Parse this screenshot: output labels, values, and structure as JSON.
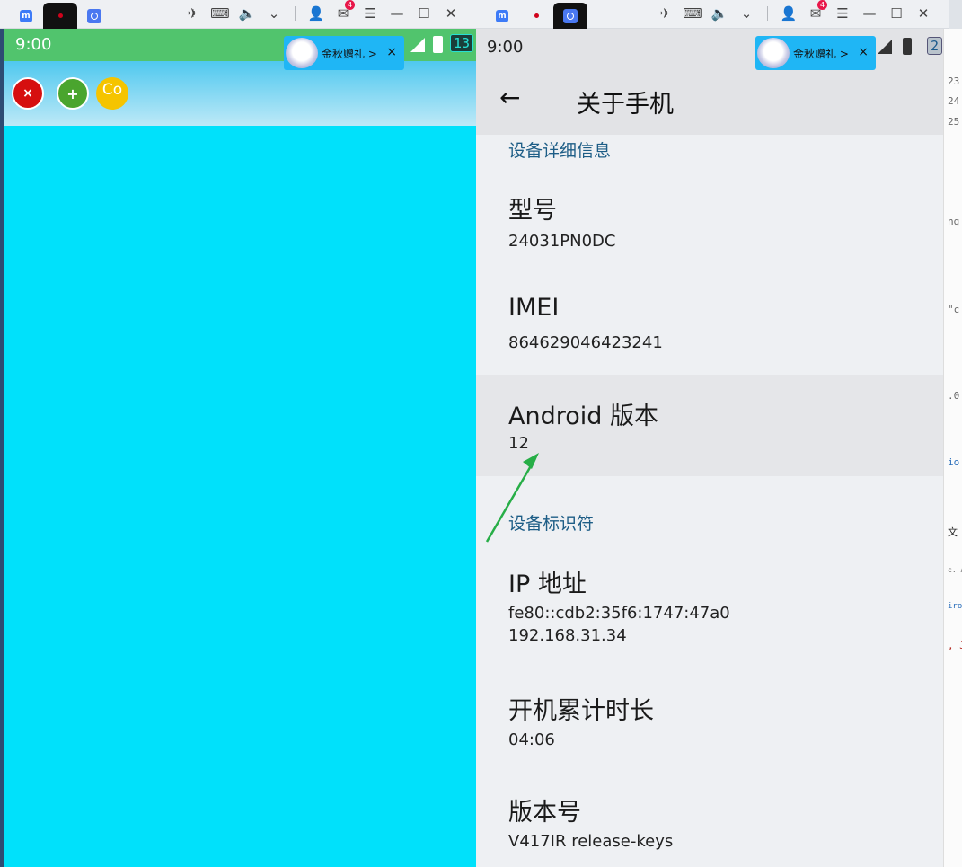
{
  "left_window": {
    "titlebar": {
      "mail_badge": "4"
    },
    "status": {
      "time": "9:00",
      "notif_count": "13"
    },
    "ad": {
      "text": "金秋赠礼",
      "chevron": ">",
      "close": "×"
    },
    "toolbar": {
      "close_label": "×",
      "add_label": "+",
      "extra_label": "Co"
    }
  },
  "right_window": {
    "titlebar": {
      "mail_badge": "4"
    },
    "status": {
      "time": "9:00",
      "notif_count": "2"
    },
    "ad": {
      "text": "金秋赠礼",
      "chevron": ">",
      "close": "×"
    },
    "appbar": {
      "back_icon": "←",
      "title": "关于手机"
    },
    "sections": {
      "device_details": "设备详细信息",
      "device_identifiers": "设备标识符"
    },
    "items": {
      "model": {
        "label": "型号",
        "value": "24031PN0DC"
      },
      "imei": {
        "label": "IMEI",
        "value": "864629046423241"
      },
      "android_version": {
        "label": "Android 版本",
        "value": "12"
      },
      "ip_address": {
        "label": "IP 地址",
        "value_line1": "fe80::cdb2:35f6:1747:47a0",
        "value_line2": "192.168.31.34"
      },
      "uptime": {
        "label": "开机累计时长",
        "value": "04:06"
      },
      "build_number": {
        "label": "版本号",
        "value": "V417IR release-keys"
      }
    }
  },
  "side_strip": {
    "lines": [
      "23",
      "24",
      "25",
      "ng",
      "\"c",
      ".0",
      "io",
      "文",
      "c. A",
      "iro",
      ", J"
    ]
  },
  "colors": {
    "accent": "#1d5d86",
    "left_bg": "#00e1fb",
    "status_green": "#51c46d",
    "arrow": "#27ae47"
  }
}
